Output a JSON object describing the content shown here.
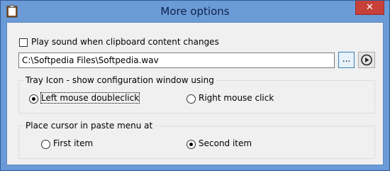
{
  "window": {
    "title": "More options",
    "close_label": "✕",
    "app_icon": "clipboard-icon"
  },
  "sound": {
    "checkbox_label": "Play sound when clipboard content changes",
    "checked": false,
    "path_value": "C:\\Softpedia Files\\Softpedia.wav",
    "browse_label": "...",
    "play_icon": "play-icon"
  },
  "tray_icon": {
    "legend": "Tray Icon - show configuration window using",
    "options": [
      {
        "label": "Left mouse doubleclick",
        "selected": true
      },
      {
        "label": "Right mouse click",
        "selected": false
      }
    ]
  },
  "paste_cursor": {
    "legend": "Place cursor in paste menu at",
    "options": [
      {
        "label": "First item",
        "selected": false
      },
      {
        "label": "Second item",
        "selected": true
      }
    ]
  }
}
